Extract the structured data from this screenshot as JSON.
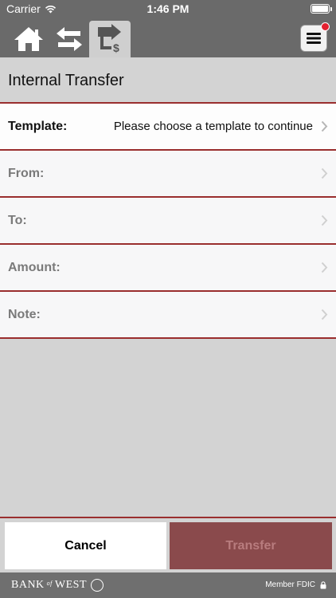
{
  "status": {
    "carrier": "Carrier",
    "time": "1:46 PM"
  },
  "nav": {
    "home_icon": "home-icon",
    "swap_icon": "swap-arrows-icon",
    "transfer_icon": "transfer-money-icon",
    "menu_icon": "hamburger-menu-icon",
    "badge_color": "#e3202f"
  },
  "page": {
    "title": "Internal Transfer"
  },
  "form": {
    "rows": [
      {
        "label": "Template:",
        "value": "Please choose a template to continue"
      },
      {
        "label": "From:",
        "value": ""
      },
      {
        "label": "To:",
        "value": ""
      },
      {
        "label": "Amount:",
        "value": ""
      },
      {
        "label": "Note:",
        "value": ""
      }
    ]
  },
  "actions": {
    "cancel": "Cancel",
    "transfer": "Transfer"
  },
  "footer": {
    "brand_left": "BANK",
    "brand_of": "of",
    "brand_right": "WEST",
    "fdic": "Member FDIC"
  },
  "colors": {
    "accent_line": "#9a2e2e",
    "transfer_button": "#8a4a4c",
    "chrome": "#6a6a6a"
  }
}
